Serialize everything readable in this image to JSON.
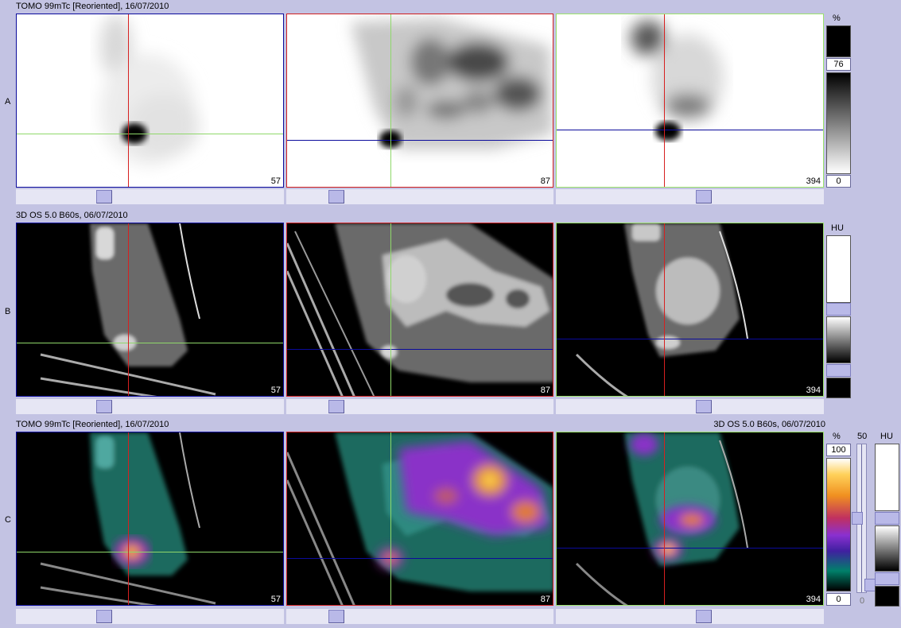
{
  "rows": {
    "a": {
      "label": "A",
      "header": "TOMO 99mTc [Reoriented], 16/07/2010",
      "unit": "%",
      "colorbar_max": "76",
      "colorbar_min": "0"
    },
    "b": {
      "label": "B",
      "header": "3D  OS  5.0  B60s, 06/07/2010",
      "unit": "HU"
    },
    "c": {
      "label": "C",
      "header_left": "TOMO 99mTc [Reoriented], 16/07/2010",
      "header_right": "3D  OS  5.0  B60s, 06/07/2010",
      "unit_pct": "%",
      "colorbar_max": "100",
      "colorbar_min": "0",
      "blend_top": "50",
      "blend_bottom": "0",
      "unit_hu": "HU"
    }
  },
  "slices": {
    "transverse": "57",
    "sagittal": "87",
    "coronal": "394"
  },
  "colors": {
    "background": "#c3c3e3",
    "transverse_frame": "#0b0b9c",
    "sagittal_frame": "#d02020",
    "coronal_frame": "#9be36b"
  }
}
